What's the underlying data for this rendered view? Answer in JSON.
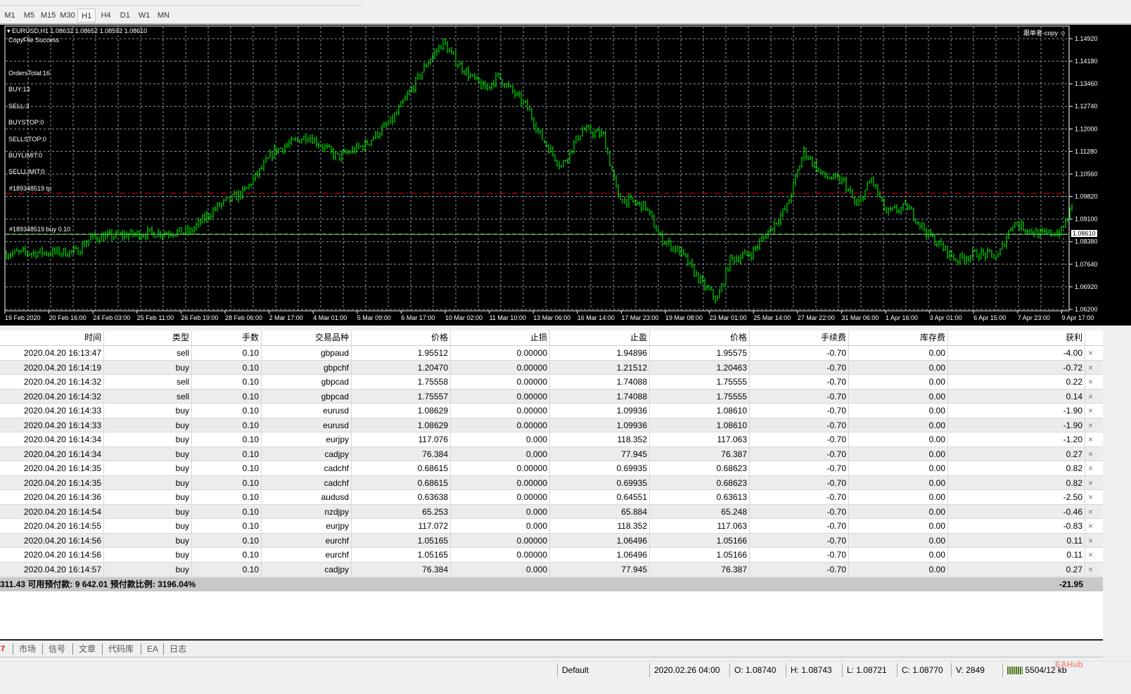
{
  "timeframes": [
    "M1",
    "M5",
    "M15",
    "M30",
    "H1",
    "H4",
    "D1",
    "W1",
    "MN"
  ],
  "active_timeframe": "H1",
  "chart": {
    "header": "EURUSD,H1  1.08632 1.08652 1.08592 1.08610",
    "status_msg": "CopyFile Success",
    "ea_name": "跟单者-copy",
    "info": [
      "OrdersTotal:16",
      "BUY:13",
      "SELL:3",
      "BUYSTOP:0",
      "SELLSTOP:0",
      "BUYLIMIT:0",
      "SELLLIMIT:0"
    ],
    "tp_label": "#189348519 tp",
    "order_label": "#189348519 buy 0.10",
    "current_price": "1.08610",
    "colors": {
      "bars": "#00ff00",
      "grid": "#8899aa",
      "tp_line": "#ff0000",
      "order_line": "#00c000",
      "background": "#000000"
    }
  },
  "chart_data": {
    "type": "line",
    "symbol": "EURUSD",
    "period": "H1",
    "ylim": [
      1.062,
      1.1525
    ],
    "y_ticks": [
      "1.14920",
      "1.14180",
      "1.13460",
      "1.12740",
      "1.12000",
      "1.11280",
      "1.10560",
      "1.09820",
      "1.09100",
      "1.08380",
      "1.07640",
      "1.06920",
      "1.06200"
    ],
    "x_ticks": [
      "19 Feb 2020",
      "20 Feb 16:00",
      "24 Feb 03:00",
      "25 Feb 11:00",
      "26 Feb 19:00",
      "28 Feb 06:00",
      "2 Mar 17:00",
      "4 Mar 01:00",
      "5 Mar 09:00",
      "6 Mar 17:00",
      "10 Mar 02:00",
      "11 Mar 10:00",
      "13 Mar 06:00",
      "16 Mar 14:00",
      "17 Mar 23:00",
      "19 Mar 08:00",
      "23 Mar 01:00",
      "25 Mar 14:00",
      "27 Mar 22:00",
      "31 Mar 06:00",
      "1 Apr 16:00",
      "3 Apr 01:00",
      "6 Apr 15:00",
      "7 Apr 23:00",
      "9 Apr 17:00"
    ],
    "close_path_bar_index": [
      0,
      33,
      40,
      67,
      87,
      100,
      113,
      127,
      143,
      157,
      170,
      183,
      193,
      200,
      207,
      213,
      220,
      227,
      233,
      247,
      253,
      263,
      273,
      283,
      290,
      303,
      310,
      320,
      330,
      337,
      343,
      353,
      360,
      370,
      378,
      387,
      397,
      403,
      410,
      417,
      427,
      437,
      450,
      460,
      470,
      477,
      490,
      500,
      505
    ],
    "close_path_price": [
      1.08,
      1.0805,
      1.085,
      1.0865,
      1.087,
      1.095,
      1.1,
      1.113,
      1.118,
      1.111,
      1.115,
      1.123,
      1.134,
      1.142,
      1.148,
      1.142,
      1.137,
      1.133,
      1.137,
      1.127,
      1.118,
      1.108,
      1.12,
      1.118,
      1.098,
      1.095,
      1.085,
      1.08,
      1.07,
      1.065,
      1.078,
      1.08,
      1.086,
      1.095,
      1.113,
      1.105,
      1.103,
      1.095,
      1.104,
      1.093,
      1.095,
      1.086,
      1.078,
      1.08,
      1.079,
      1.09,
      1.086,
      1.087,
      1.095
    ],
    "tp_level": 1.09936,
    "order_level": 1.08629,
    "current_level": 1.0861
  },
  "table": {
    "headers": [
      "时间",
      "类型",
      "手数",
      "交易品种",
      "价格",
      "止损",
      "止盈",
      "价格",
      "手续费",
      "库存费",
      "获利"
    ],
    "rows": [
      [
        "2020.04.20 16:13:47",
        "sell",
        "0.10",
        "gbpaud",
        "1.95512",
        "0.00000",
        "1.94896",
        "1.95575",
        "-0.70",
        "0.00",
        "-4.00"
      ],
      [
        "2020.04.20 16:14:19",
        "buy",
        "0.10",
        "gbpchf",
        "1.20470",
        "0.00000",
        "1.21512",
        "1.20463",
        "-0.70",
        "0.00",
        "-0.72"
      ],
      [
        "2020.04.20 16:14:32",
        "sell",
        "0.10",
        "gbpcad",
        "1.75558",
        "0.00000",
        "1.74088",
        "1.75555",
        "-0.70",
        "0.00",
        "0.22"
      ],
      [
        "2020.04.20 16:14:32",
        "sell",
        "0.10",
        "gbpcad",
        "1.75557",
        "0.00000",
        "1.74088",
        "1.75555",
        "-0.70",
        "0.00",
        "0.14"
      ],
      [
        "2020.04.20 16:14:33",
        "buy",
        "0.10",
        "eurusd",
        "1.08629",
        "0.00000",
        "1.09936",
        "1.08610",
        "-0.70",
        "0.00",
        "-1.90"
      ],
      [
        "2020.04.20 16:14:33",
        "buy",
        "0.10",
        "eurusd",
        "1.08629",
        "0.00000",
        "1.09936",
        "1.08610",
        "-0.70",
        "0.00",
        "-1.90"
      ],
      [
        "2020.04.20 16:14:34",
        "buy",
        "0.10",
        "eurjpy",
        "117.076",
        "0.000",
        "118.352",
        "117.063",
        "-0.70",
        "0.00",
        "-1.20"
      ],
      [
        "2020.04.20 16:14:34",
        "buy",
        "0.10",
        "cadjpy",
        "76.384",
        "0.000",
        "77.945",
        "76.387",
        "-0.70",
        "0.00",
        "0.27"
      ],
      [
        "2020.04.20 16:14:35",
        "buy",
        "0.10",
        "cadchf",
        "0.68615",
        "0.00000",
        "0.69935",
        "0.68623",
        "-0.70",
        "0.00",
        "0.82"
      ],
      [
        "2020.04.20 16:14:35",
        "buy",
        "0.10",
        "cadchf",
        "0.68615",
        "0.00000",
        "0.69935",
        "0.68623",
        "-0.70",
        "0.00",
        "0.82"
      ],
      [
        "2020.04.20 16:14:36",
        "buy",
        "0.10",
        "audusd",
        "0.63638",
        "0.00000",
        "0.64551",
        "0.63613",
        "-0.70",
        "0.00",
        "-2.50"
      ],
      [
        "2020.04.20 16:14:54",
        "buy",
        "0.10",
        "nzdjpy",
        "65.253",
        "0.000",
        "65.884",
        "65.248",
        "-0.70",
        "0.00",
        "-0.46"
      ],
      [
        "2020.04.20 16:14:55",
        "buy",
        "0.10",
        "eurjpy",
        "117.072",
        "0.000",
        "118.352",
        "117.063",
        "-0.70",
        "0.00",
        "-0.83"
      ],
      [
        "2020.04.20 16:14:56",
        "buy",
        "0.10",
        "eurchf",
        "1.05165",
        "0.00000",
        "1.06496",
        "1.05166",
        "-0.70",
        "0.00",
        "0.11"
      ],
      [
        "2020.04.20 16:14:56",
        "buy",
        "0.10",
        "eurchf",
        "1.05165",
        "0.00000",
        "1.06496",
        "1.05166",
        "-0.70",
        "0.00",
        "0.11"
      ],
      [
        "2020.04.20 16:14:57",
        "buy",
        "0.10",
        "cadjpy",
        "76.384",
        "0.000",
        "77.945",
        "76.387",
        "-0.70",
        "0.00",
        "0.27"
      ]
    ],
    "close_glyph": "×"
  },
  "summary": {
    "text": "311.43  可用预付款: 9 642.01  预付款比例: 3196.04%",
    "total_profit": "-21.95"
  },
  "tabs": {
    "count_badge": "7",
    "items": [
      "市场",
      "信号",
      "文章",
      "代码库",
      "EA",
      "日志"
    ]
  },
  "status": {
    "profile": "Default",
    "datetime": "2020.02.26 04:00",
    "open": "O: 1.08740",
    "high": "H: 1.08743",
    "low": "L: 1.08721",
    "close": "C: 1.08770",
    "volume": "V: 2849",
    "traffic": "5504/12 kb",
    "watermark": "EAHub"
  }
}
